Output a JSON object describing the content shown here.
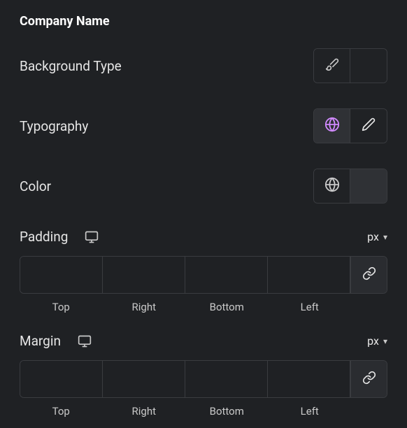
{
  "section": {
    "title": "Company Name"
  },
  "rows": {
    "backgroundType": {
      "label": "Background Type"
    },
    "typography": {
      "label": "Typography"
    },
    "color": {
      "label": "Color",
      "swatch": "#6e3a3a"
    }
  },
  "spacing": {
    "padding": {
      "label": "Padding",
      "unit": "px",
      "values": {
        "top": "",
        "right": "",
        "bottom": "",
        "left": ""
      },
      "sides": {
        "top": "Top",
        "right": "Right",
        "bottom": "Bottom",
        "left": "Left"
      }
    },
    "margin": {
      "label": "Margin",
      "unit": "px",
      "values": {
        "top": "",
        "right": "",
        "bottom": "",
        "left": ""
      },
      "sides": {
        "top": "Top",
        "right": "Right",
        "bottom": "Bottom",
        "left": "Left"
      }
    }
  }
}
